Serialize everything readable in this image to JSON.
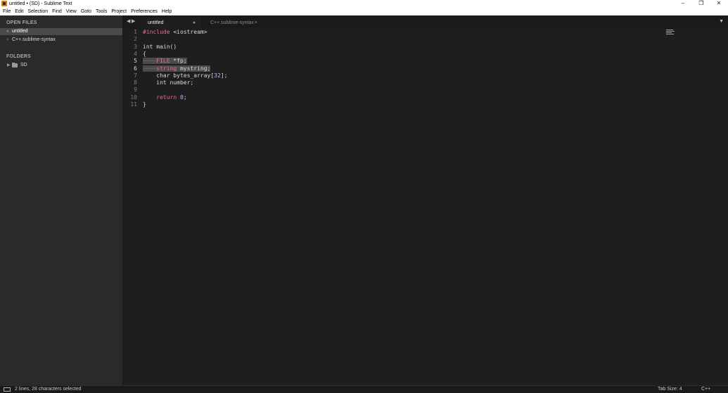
{
  "window": {
    "title": "untitled • (SD) - Sublime Text",
    "minimize_glyph": "–",
    "restore_glyph": "❐",
    "close_glyph": "✕"
  },
  "menu": [
    "File",
    "Edit",
    "Selection",
    "Find",
    "View",
    "Goto",
    "Tools",
    "Project",
    "Preferences",
    "Help"
  ],
  "sidebar": {
    "open_files_header": "OPEN FILES",
    "open_files": [
      {
        "name": "untitled",
        "marker": "●",
        "active": true
      },
      {
        "name": "C++.sublime-syntax",
        "marker": "×",
        "active": false
      }
    ],
    "folders_header": "FOLDERS",
    "folders": [
      {
        "name": "SD",
        "expander": "▶"
      }
    ]
  },
  "tabs": {
    "back_glyph": "◀",
    "forward_glyph": "▶",
    "dropdown_glyph": "▼",
    "items": [
      {
        "label": "untitled",
        "mark": "●",
        "active": true
      },
      {
        "label": "C++.sublime-syntax",
        "mark": "×",
        "active": false
      }
    ]
  },
  "editor": {
    "line_numbers": [
      "1",
      "2",
      "3",
      "4",
      "5",
      "6",
      "7",
      "8",
      "9",
      "10",
      "11"
    ],
    "selected_lines": [
      5,
      6
    ],
    "code": {
      "l1_directive": "#include",
      "l1_rest": " <iostream>",
      "l3": "int main()",
      "l4": "{",
      "l5_guide": "────",
      "l5_type": "FILE",
      "l5_rest": " *fp;",
      "l6_guide": "────",
      "l6_type": "string",
      "l6_rest": " mystring;",
      "l7_indent": "    ",
      "l7_type": "char",
      "l7_mid": " bytes_array[",
      "l7_num": "32",
      "l7_end": "];",
      "l8": "    int number;",
      "l10_indent": "    ",
      "l10_kw": "return",
      "l10_sp": " ",
      "l10_num": "0",
      "l10_end": ";",
      "l11": "}"
    }
  },
  "status": {
    "message": "2 lines, 28 characters selected",
    "tab_size": "Tab Size: 4",
    "syntax": "C++"
  },
  "colors": {
    "background": "#1e1e1e",
    "sidebar": "#2a2a2a",
    "keyword": "#f26a88",
    "number": "#d7a9f5",
    "selection": "#4a4a4a"
  }
}
